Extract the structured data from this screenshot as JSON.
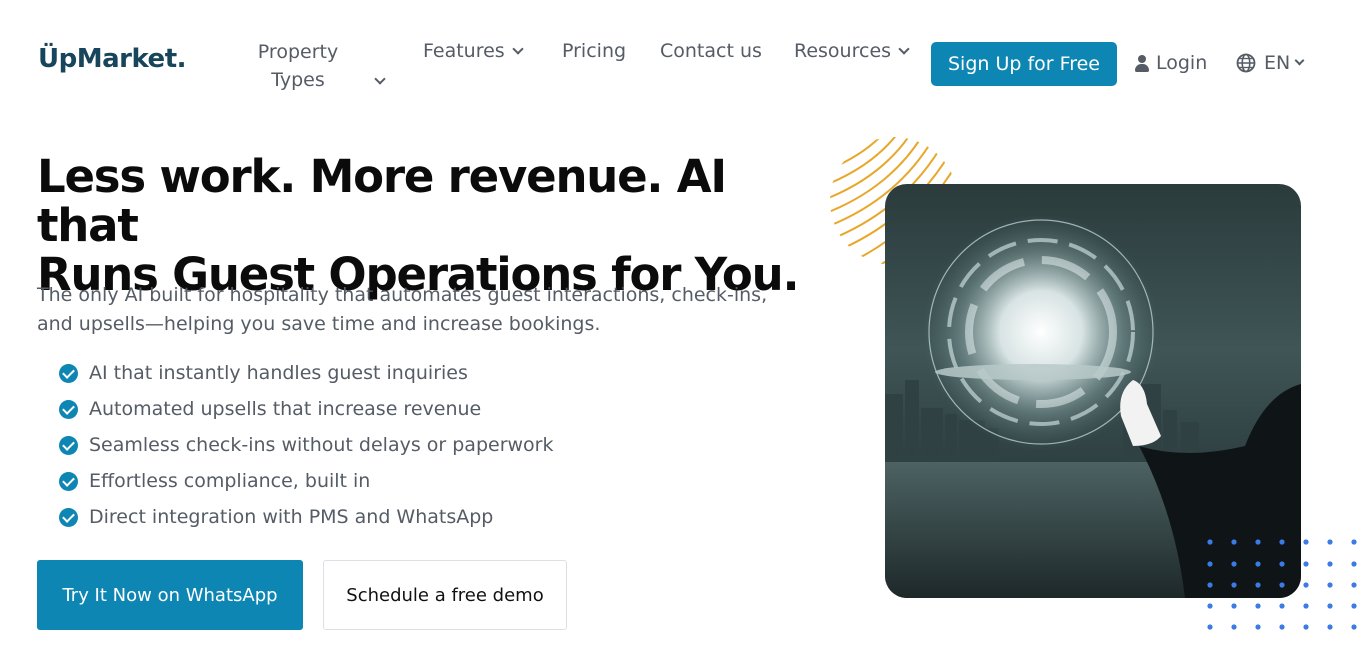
{
  "header": {
    "logo": "ÜpMarket.",
    "nav": {
      "property_line1": "Property",
      "property_line2": "Types",
      "features": "Features",
      "pricing": "Pricing",
      "contact": "Contact us",
      "resources": "Resources"
    },
    "signup_label": "Sign Up for Free",
    "login_label": "Login",
    "language": "EN"
  },
  "hero": {
    "headline_line1": "Less work. More revenue. AI that",
    "headline_line2": "Runs Guest Operations for You.",
    "subtext": "The only AI built for hospitality that automates guest interactions, check-ins, and upsells—helping you save time and increase bookings.",
    "features": [
      "AI that instantly handles guest inquiries",
      "Automated upsells that increase revenue",
      "Seamless check-ins without delays or paperwork",
      "Effortless compliance, built in",
      "Direct integration with PMS and WhatsApp"
    ],
    "cta_primary": "Try It Now on WhatsApp",
    "cta_secondary": "Schedule a free demo"
  },
  "colors": {
    "brand": "#0e86b3",
    "logo": "#17455c",
    "accent_lines": "#e8a72a",
    "accent_dots": "#3b7be6"
  },
  "icons": [
    "chevron-down-icon",
    "user-icon",
    "globe-icon",
    "check-circle-icon"
  ]
}
